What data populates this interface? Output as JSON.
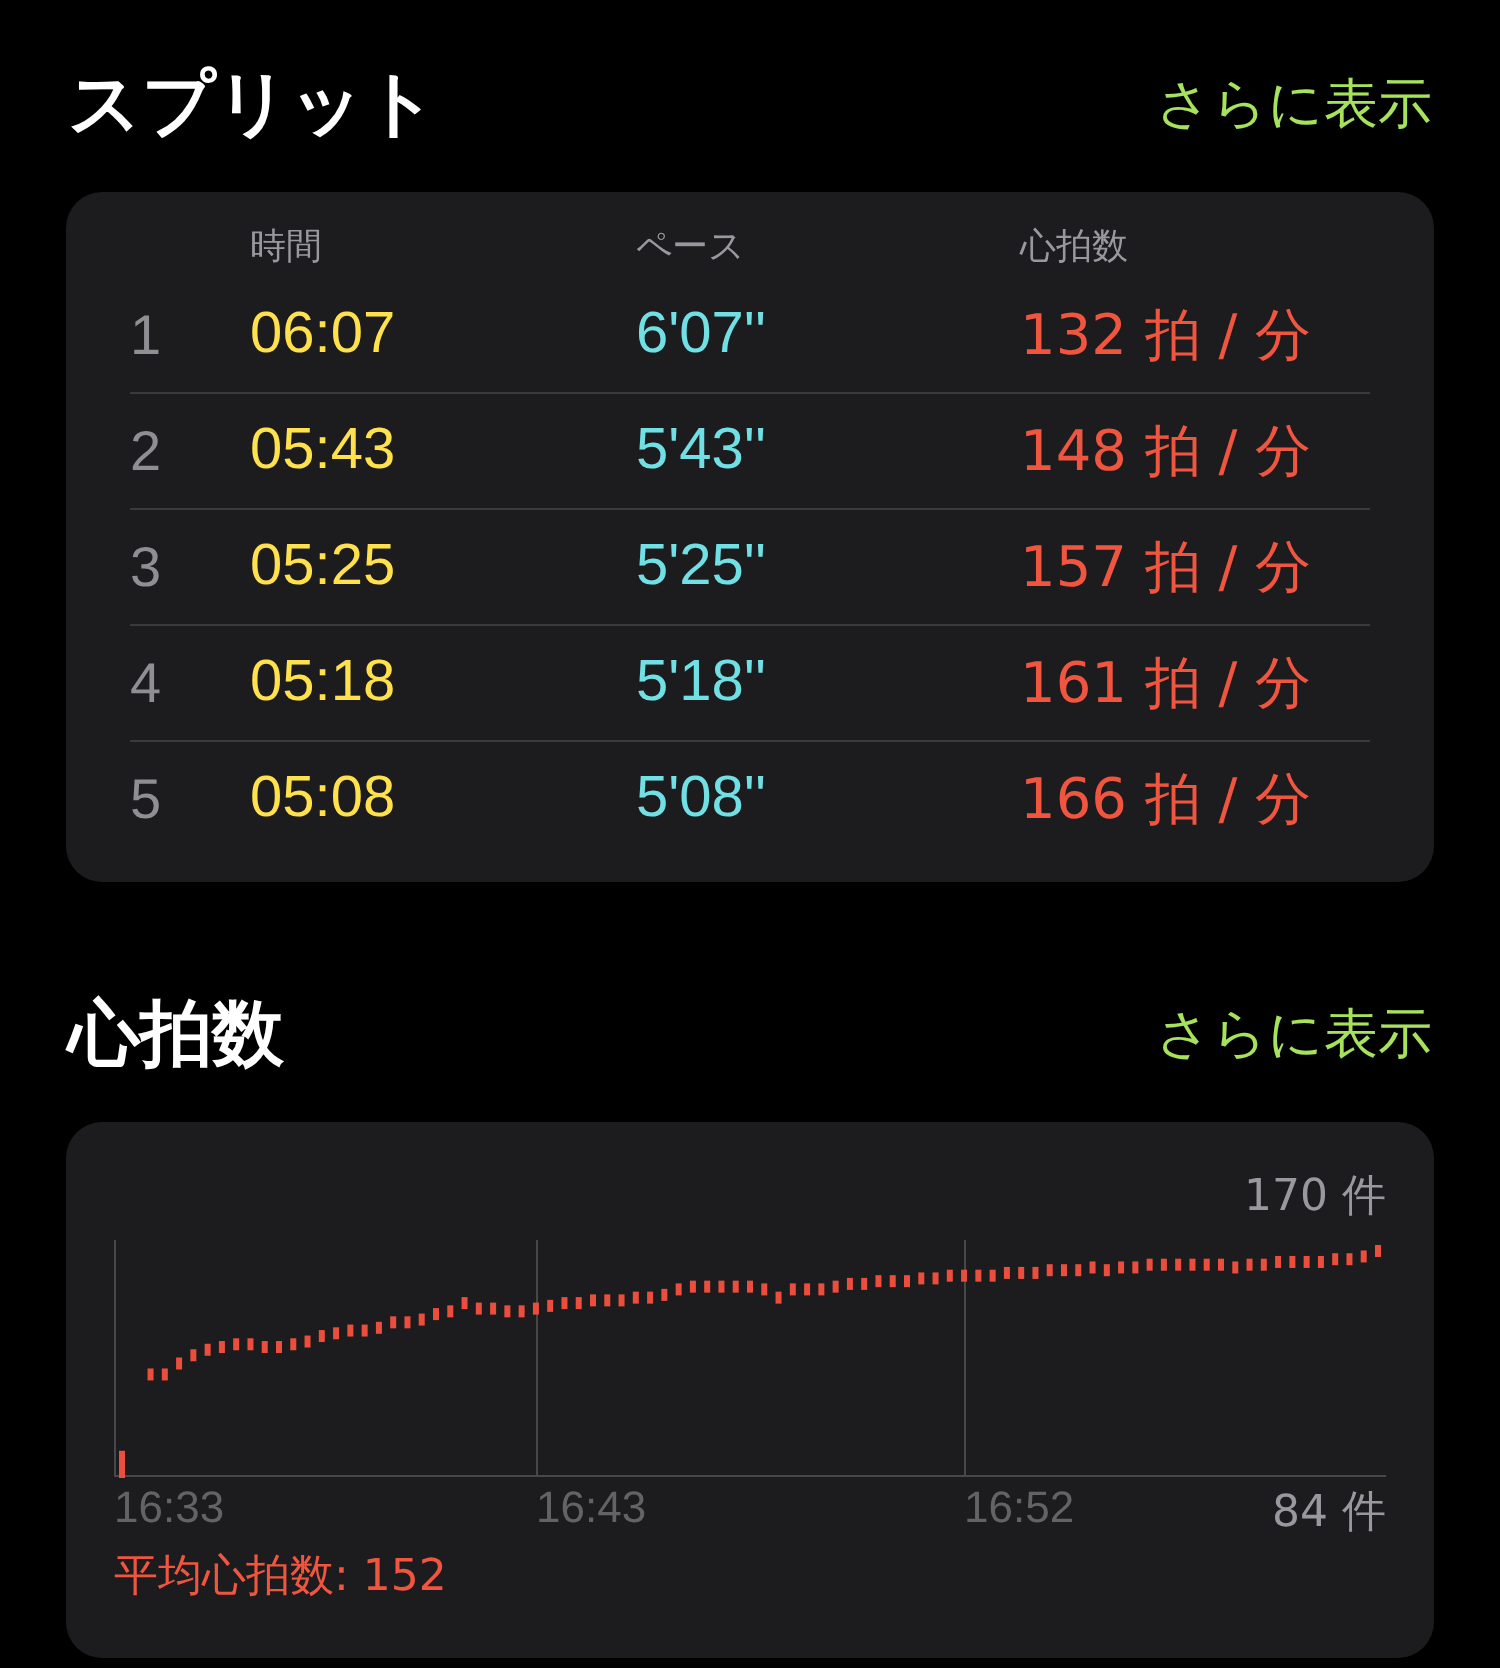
{
  "splits": {
    "title": "スプリット",
    "more": "さらに表示",
    "columns": [
      {
        "label": "時間"
      },
      {
        "label": "ペース"
      },
      {
        "label": "心拍数"
      }
    ],
    "rows": [
      {
        "index": "1",
        "time": "06:07",
        "pace": "6'07''",
        "heart_rate": "132 拍 / 分"
      },
      {
        "index": "2",
        "time": "05:43",
        "pace": "5'43''",
        "heart_rate": "148 拍 / 分"
      },
      {
        "index": "3",
        "time": "05:25",
        "pace": "5'25''",
        "heart_rate": "157 拍 / 分"
      },
      {
        "index": "4",
        "time": "05:18",
        "pace": "5'18''",
        "heart_rate": "161 拍 / 分"
      },
      {
        "index": "5",
        "time": "05:08",
        "pace": "5'08''",
        "heart_rate": "166 拍 / 分"
      }
    ]
  },
  "heart_rate": {
    "title": "心拍数",
    "more": "さらに表示",
    "max_label": "170 件",
    "min_label": "84 件",
    "time_labels": [
      "16:33",
      "16:43",
      "16:52"
    ],
    "average": "平均心拍数: 152"
  }
}
